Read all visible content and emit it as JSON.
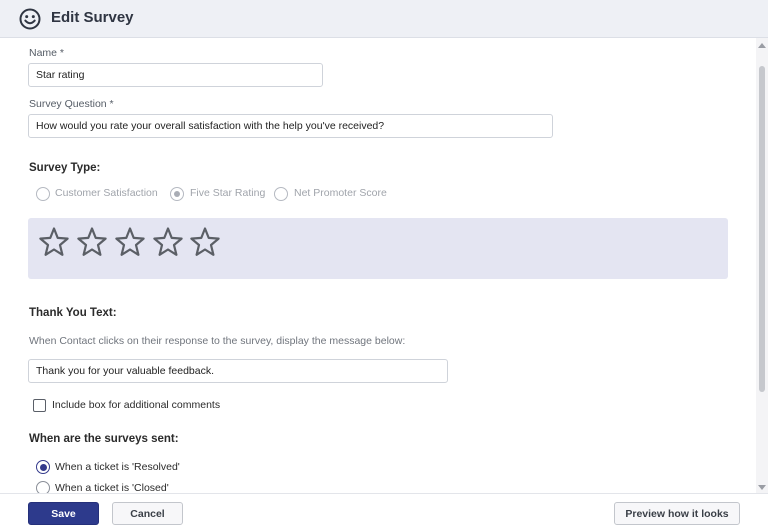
{
  "header": {
    "title": "Edit Survey",
    "icon": "smiley-icon"
  },
  "form": {
    "name_label": "Name *",
    "name_value": "Star rating",
    "question_label": "Survey Question *",
    "question_value": "How would you rate your overall satisfaction with the help you've received?",
    "survey_type_title": "Survey Type:",
    "survey_types": [
      {
        "label": "Customer Satisfaction",
        "selected": false
      },
      {
        "label": "Five Star Rating",
        "selected": true
      },
      {
        "label": "Net Promoter Score",
        "selected": false
      }
    ],
    "star_count": 5,
    "thank_you_title": "Thank You Text:",
    "thank_you_hint": "When Contact clicks on their response to the survey, display the message below:",
    "thank_you_value": "Thank you for your valuable feedback.",
    "include_comments_label": "Include box for additional comments",
    "include_comments_checked": false,
    "sent_title": "When are the surveys sent:",
    "sent_options": [
      {
        "label": "When a ticket is 'Resolved'",
        "selected": true
      },
      {
        "label": "When a ticket is 'Closed'",
        "selected": false
      }
    ]
  },
  "footer": {
    "save_label": "Save",
    "cancel_label": "Cancel",
    "preview_label": "Preview how it looks"
  },
  "colors": {
    "primary": "#2d3a8c",
    "header_bg": "#eef0f5",
    "star_panel_bg": "#e4e5f2",
    "star_stroke": "#5b5f66"
  }
}
